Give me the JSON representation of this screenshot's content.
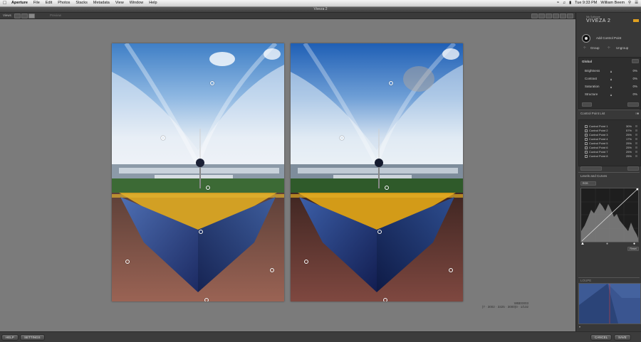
{
  "menubar": {
    "app": "Aperture",
    "items": [
      "File",
      "Edit",
      "Photos",
      "Stacks",
      "Metadata",
      "View",
      "Window",
      "Help"
    ],
    "clock": "Tue 9:33 PM",
    "user": "William Beem"
  },
  "window": {
    "title": "Viveza 2"
  },
  "toolbar": {
    "views_label": "Views",
    "preview_label": "Preview"
  },
  "image_info": {
    "filename": "WBE0003",
    "details": "(7 · 3002 · 3325 · 3000)0 · 1/132"
  },
  "panel": {
    "brand_small": "Nik Software",
    "brand": "VIVEZA 2",
    "add_control_point": "Add Control Point",
    "group": "Group",
    "ungroup": "Ungroup",
    "global": {
      "title": "Global",
      "sliders": [
        {
          "label": "Brightness",
          "value": "0%"
        },
        {
          "label": "Contrast",
          "value": "0%"
        },
        {
          "label": "Saturation",
          "value": "0%"
        },
        {
          "label": "Structure",
          "value": "0%"
        }
      ]
    },
    "control_point_list_title": "Control Point List",
    "control_points": [
      {
        "name": "Control Point 1",
        "value": "30%"
      },
      {
        "name": "Control Point 2",
        "value": "57%"
      },
      {
        "name": "Control Point 3",
        "value": "25%"
      },
      {
        "name": "Control Point 4",
        "value": "17%"
      },
      {
        "name": "Control Point 5",
        "value": "25%"
      },
      {
        "name": "Control Point 6",
        "value": "25%"
      },
      {
        "name": "Control Point 7",
        "value": "25%"
      },
      {
        "name": "Control Point 8",
        "value": "25%"
      }
    ],
    "levels_title": "Levels and Curves",
    "channel": "RGB",
    "reset": "Reset",
    "loupe_title": "LOUPE"
  },
  "bottom": {
    "help": "HELP",
    "settings": "SETTINGS",
    "cancel": "CANCEL",
    "save": "SAVE"
  }
}
